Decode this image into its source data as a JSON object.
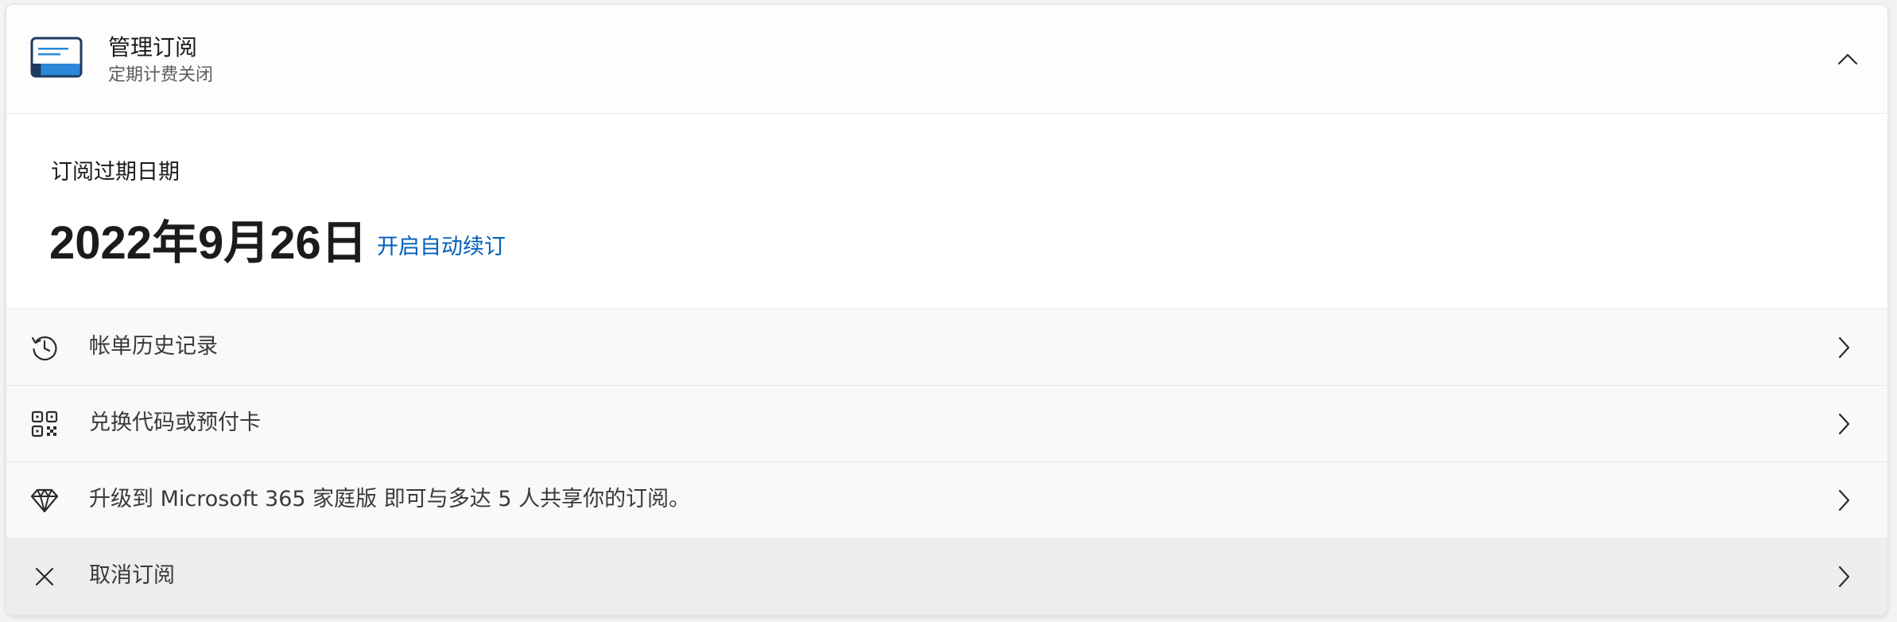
{
  "header": {
    "title": "管理订阅",
    "subtitle": "定期计费关闭",
    "icon": "card-icon",
    "collapse_icon": "chevron-up-icon"
  },
  "expiry": {
    "label": "订阅过期日期",
    "date": "2022年9月26日",
    "renew_link": "开启自动续订"
  },
  "rows": [
    {
      "label": "帐单历史记录",
      "icon": "history-icon"
    },
    {
      "label": "兑换代码或预付卡",
      "icon": "qr-code-icon"
    },
    {
      "label": "升级到 Microsoft 365 家庭版 即可与多达 5 人共享你的订阅。",
      "icon": "diamond-icon"
    },
    {
      "label": "取消订阅",
      "icon": "close-icon"
    }
  ],
  "colors": {
    "accent": "#005fb8",
    "card_icon_blue": "#2b88d8",
    "card_icon_dark": "#1f3a5f"
  }
}
